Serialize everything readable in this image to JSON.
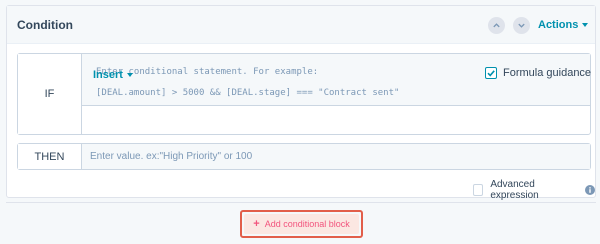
{
  "condition_panel": {
    "title": "Condition",
    "actions_label": "Actions"
  },
  "if_block": {
    "label": "IF",
    "placeholder_line1": "Enter conditional statement. For example:",
    "placeholder_line2": "[DEAL.amount] > 5000 && [DEAL.stage] === \"Contract sent\"",
    "insert_label": "Insert",
    "formula_guidance_label": "Formula guidance",
    "formula_guidance_checked": true
  },
  "then_block": {
    "label": "THEN",
    "placeholder": "Enter value. ex:\"High Priority\" or 100",
    "value": ""
  },
  "advanced_expression": {
    "label": "Advanced expression",
    "checked": false
  },
  "add_block_button": {
    "label": "Add conditional block"
  },
  "colors": {
    "accent": "#0091ae",
    "highlight_border": "#e25e4a",
    "add_button_text": "#f2547d"
  }
}
